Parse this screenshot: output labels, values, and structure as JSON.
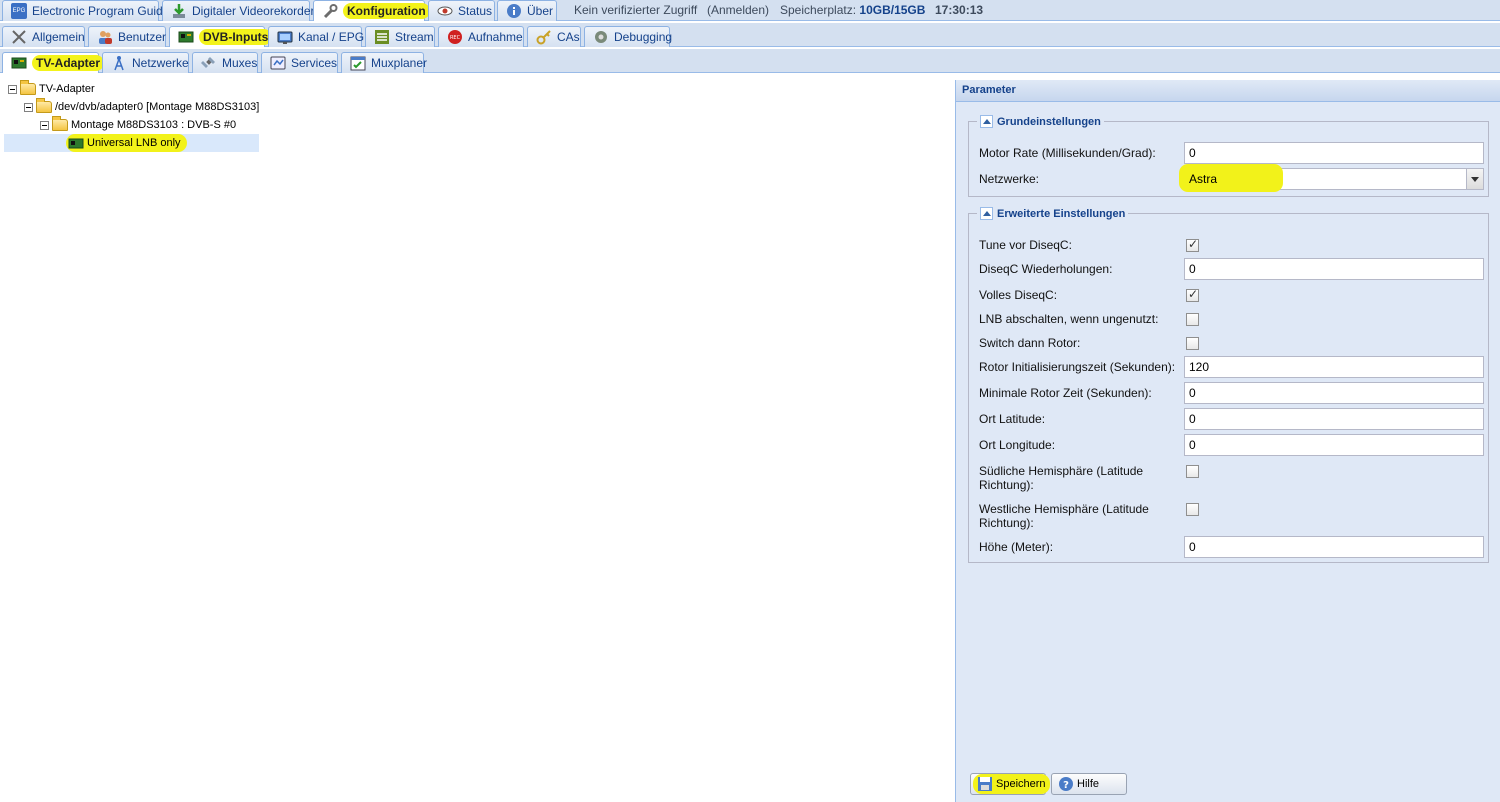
{
  "top_tabs": [
    {
      "label": "Electronic Program Guide",
      "icon": "epg-icon"
    },
    {
      "label": "Digitaler Videorekorder",
      "icon": "download-icon"
    },
    {
      "label": "Konfiguration",
      "icon": "wrench-icon",
      "active": true
    },
    {
      "label": "Status",
      "icon": "eye-icon"
    },
    {
      "label": "Über",
      "icon": "info-icon"
    }
  ],
  "status_bar": {
    "access": "Kein verifizierter Zugriff",
    "login": "(Anmelden)",
    "storage_label": "Speicherplatz:",
    "storage_value": "10GB/15GB",
    "time": "17:30:13"
  },
  "config_tabs": [
    {
      "label": "Allgemein",
      "icon": "tools-icon"
    },
    {
      "label": "Benutzer",
      "icon": "users-icon"
    },
    {
      "label": "DVB-Inputs",
      "icon": "tv-card-icon",
      "active": true
    },
    {
      "label": "Kanal / EPG",
      "icon": "tv-icon"
    },
    {
      "label": "Stream",
      "icon": "stream-icon"
    },
    {
      "label": "Aufnahme",
      "icon": "rec-icon"
    },
    {
      "label": "CAs",
      "icon": "key-icon"
    },
    {
      "label": "Debugging",
      "icon": "debug-icon"
    }
  ],
  "dvb_tabs": [
    {
      "label": "TV-Adapter",
      "icon": "tv-card-icon",
      "active": true
    },
    {
      "label": "Netzwerke",
      "icon": "antenna-icon"
    },
    {
      "label": "Muxes",
      "icon": "satellite-icon"
    },
    {
      "label": "Services",
      "icon": "services-icon"
    },
    {
      "label": "Muxplaner",
      "icon": "calendar-icon"
    }
  ],
  "tree": {
    "root": "TV-Adapter",
    "adapter": "/dev/dvb/adapter0 [Montage M88DS3103]",
    "frontend": "Montage M88DS3103 : DVB-S #0",
    "lnb": "Universal LNB only"
  },
  "panel": {
    "title": "Parameter",
    "basic": {
      "legend": "Grundeinstellungen",
      "motor_rate_label": "Motor Rate (Millisekunden/Grad):",
      "motor_rate_value": "0",
      "networks_label": "Netzwerke:",
      "networks_value": "Astra"
    },
    "advanced": {
      "legend": "Erweiterte Einstellungen",
      "tune_before_diseqc_label": "Tune vor DiseqC:",
      "tune_before_diseqc": true,
      "diseqc_repeats_label": "DiseqC Wiederholungen:",
      "diseqc_repeats_value": "0",
      "full_diseqc_label": "Volles DiseqC:",
      "full_diseqc": true,
      "lnb_poweroff_label": "LNB abschalten, wenn ungenutzt:",
      "lnb_poweroff": false,
      "switch_then_rotor_label": "Switch dann Rotor:",
      "switch_then_rotor": false,
      "rotor_init_label": "Rotor Initialisierungszeit (Sekunden):",
      "rotor_init_value": "120",
      "min_rotor_label": "Minimale Rotor Zeit (Sekunden):",
      "min_rotor_value": "0",
      "latitude_label": "Ort Latitude:",
      "latitude_value": "0",
      "longitude_label": "Ort Longitude:",
      "longitude_value": "0",
      "southern_label": "Südliche Hemisphäre (Latitude Richtung):",
      "southern": false,
      "western_label": "Westliche Hemisphäre (Latitude Richtung):",
      "western": false,
      "altitude_label": "Höhe (Meter):",
      "altitude_value": "0"
    },
    "save_label": "Speichern",
    "help_label": "Hilfe"
  },
  "colors": {
    "highlight": "#f2f21a",
    "tab_bar": "#d4e0f0",
    "panel_bg": "#dfe8f6",
    "accent": "#15428b"
  }
}
